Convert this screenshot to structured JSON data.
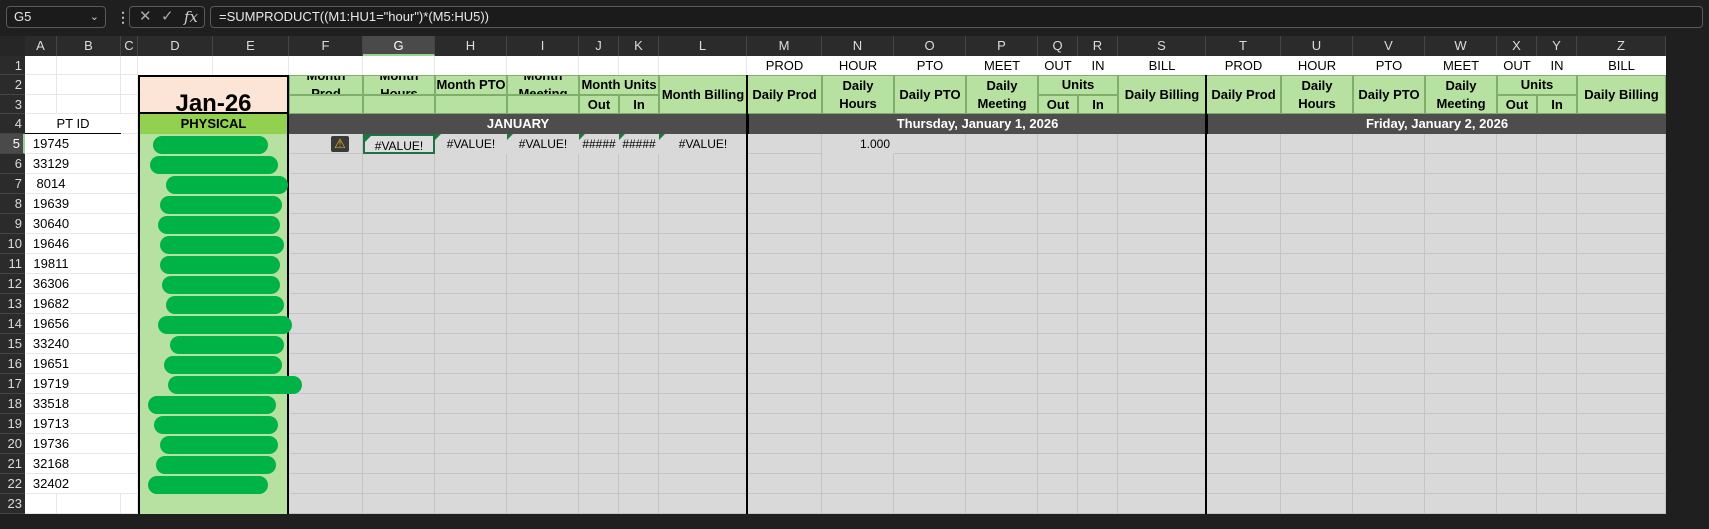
{
  "namebox": {
    "value": "G5",
    "chevron_icon": "chevron-down-icon"
  },
  "formula_bar": {
    "more_icon": "vertical-ellipsis-icon",
    "cancel_icon": "x-icon",
    "enter_icon": "checkmark-icon",
    "fx_label": "fx",
    "formula": "=SUMPRODUCT((M1:HU1=\"hour\")*(M5:HU5))"
  },
  "colors": {
    "light_green": "#b7e1a1",
    "mid_green": "#92d050",
    "salmon": "#fce4d6",
    "band_gray": "#4d4d4d",
    "grid_gray": "#d9d9d9",
    "redaction_green": "#00b347"
  },
  "columns": [
    "A",
    "B",
    "C",
    "D",
    "E",
    "F",
    "G",
    "H",
    "I",
    "J",
    "K",
    "L",
    "M",
    "N",
    "O",
    "P",
    "Q",
    "R",
    "S",
    "T",
    "U",
    "V",
    "W",
    "X",
    "Y",
    "Z"
  ],
  "rows": [
    "1",
    "2",
    "3",
    "4",
    "5",
    "6",
    "7",
    "8",
    "9",
    "10",
    "11",
    "12",
    "13",
    "14",
    "15",
    "16",
    "17",
    "18",
    "19",
    "20",
    "21",
    "22",
    "23"
  ],
  "row1_labels": [
    "PROD",
    "HOUR",
    "PTO",
    "MEET",
    "OUT",
    "IN",
    "BILL",
    "PROD",
    "HOUR",
    "PTO",
    "MEET",
    "OUT",
    "IN",
    "BILL"
  ],
  "month_label": "Jan-26",
  "month_headers": [
    "Month Prod",
    "Month Hours",
    "Month PTO",
    "Month Meeting",
    "Month Units",
    "Month Billing"
  ],
  "daily_headers": [
    "Daily Prod",
    "Daily Hours",
    "Daily PTO",
    "Daily Meeting",
    "Units",
    "Daily Billing"
  ],
  "units_sub": [
    "Out",
    "In"
  ],
  "pt_id_header": "PT ID",
  "physical_label": "PHYSICAL",
  "month_band": "JANUARY",
  "day_bands": [
    "Thursday, January 1, 2026",
    "Friday, January 2, 2026"
  ],
  "pt_ids": [
    "19745",
    "33129",
    "8014",
    "19639",
    "30640",
    "19646",
    "19811",
    "36306",
    "19682",
    "19656",
    "33240",
    "19651",
    "19719",
    "33518",
    "19713",
    "19736",
    "32168",
    "32402"
  ],
  "row5": {
    "G": "#VALUE!",
    "H": "#VALUE!",
    "I": "#VALUE!",
    "J": "#####",
    "K": "#####",
    "L": "#VALUE!",
    "N": "1.000"
  },
  "warning_icon": "warning-icon"
}
